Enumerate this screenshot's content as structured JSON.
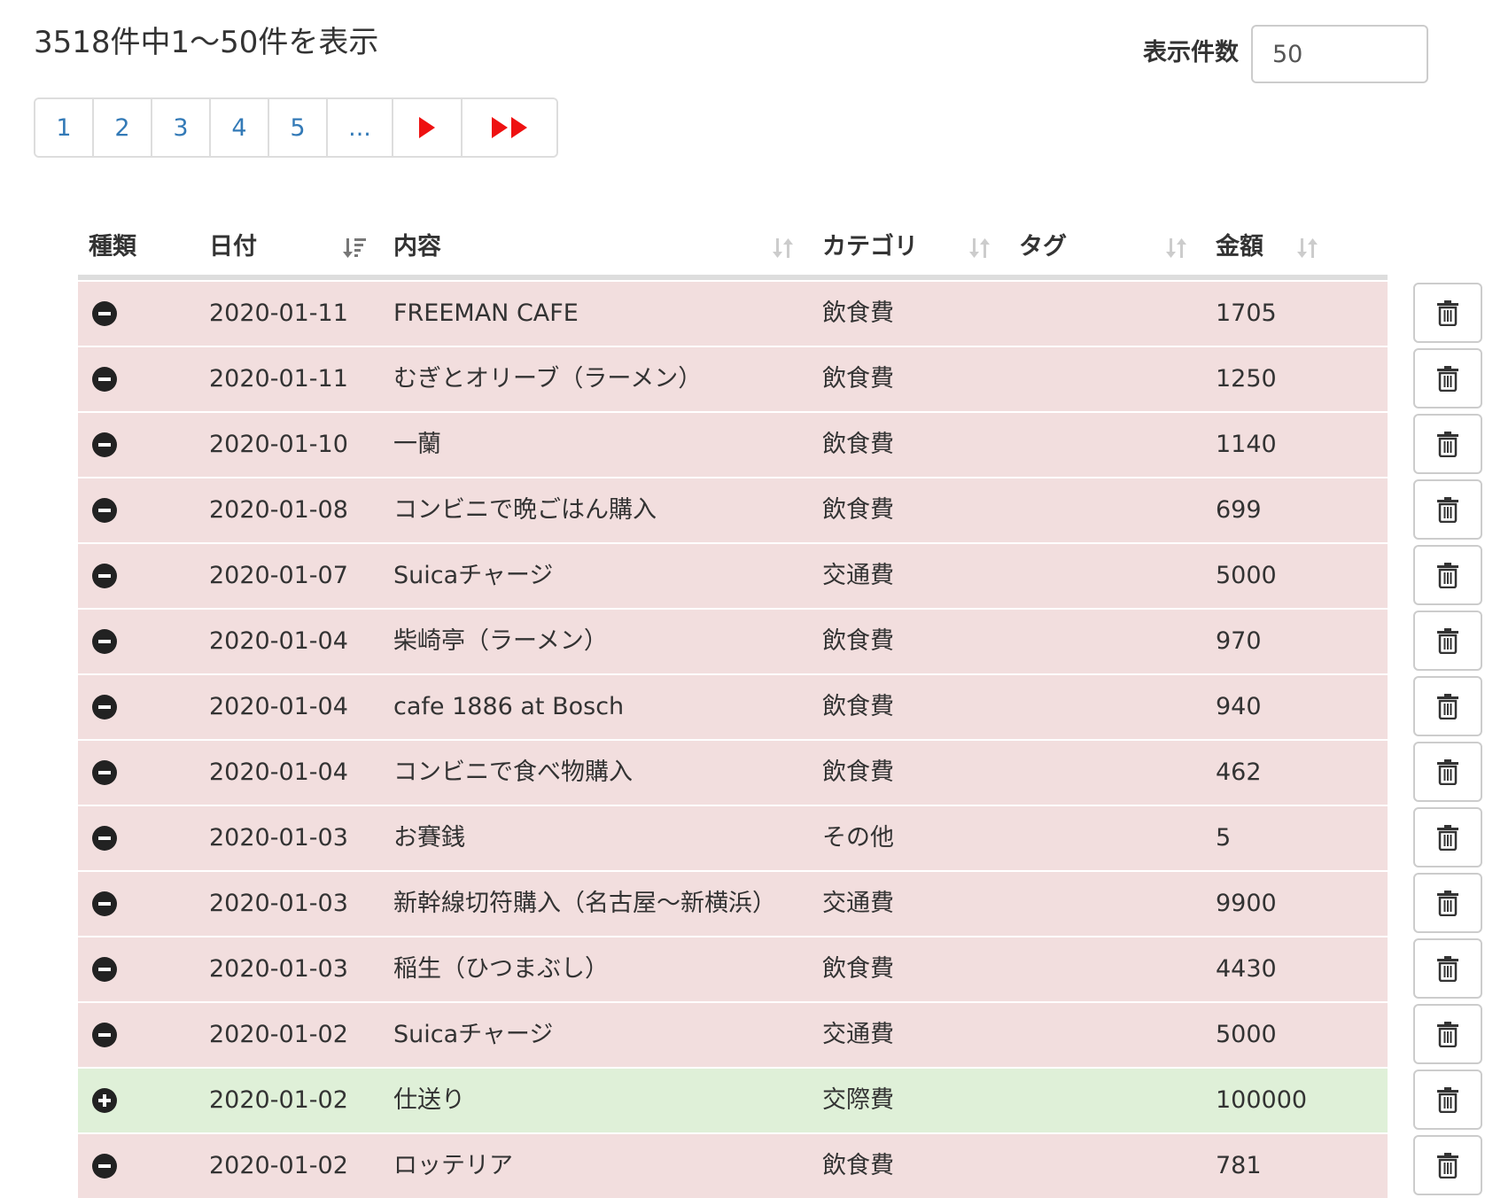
{
  "summary": "3518件中1〜50件を表示",
  "per_page": {
    "label": "表示件数",
    "value": "50"
  },
  "pagination": {
    "pages": [
      "1",
      "2",
      "3",
      "4",
      "5"
    ],
    "ellipsis": "...",
    "next_icon": "next-triangle-icon",
    "last_icon": "last-double-triangle-icon",
    "arrow_color": "#ee1111",
    "link_color": "#337ab7"
  },
  "table": {
    "columns": {
      "type": "種類",
      "date": "日付",
      "content": "内容",
      "category": "カテゴリ",
      "tag": "タグ",
      "amount": "金額"
    },
    "rows": [
      {
        "kind": "expense",
        "date": "2020-01-11",
        "content": "FREEMAN CAFE",
        "category": "飲食費",
        "tag": "",
        "amount": "1705"
      },
      {
        "kind": "expense",
        "date": "2020-01-11",
        "content": "むぎとオリーブ（ラーメン）",
        "category": "飲食費",
        "tag": "",
        "amount": "1250"
      },
      {
        "kind": "expense",
        "date": "2020-01-10",
        "content": "一蘭",
        "category": "飲食費",
        "tag": "",
        "amount": "1140"
      },
      {
        "kind": "expense",
        "date": "2020-01-08",
        "content": "コンビニで晩ごはん購入",
        "category": "飲食費",
        "tag": "",
        "amount": "699"
      },
      {
        "kind": "expense",
        "date": "2020-01-07",
        "content": "Suicaチャージ",
        "category": "交通費",
        "tag": "",
        "amount": "5000"
      },
      {
        "kind": "expense",
        "date": "2020-01-04",
        "content": "柴崎亭（ラーメン）",
        "category": "飲食費",
        "tag": "",
        "amount": "970"
      },
      {
        "kind": "expense",
        "date": "2020-01-04",
        "content": "cafe 1886 at Bosch",
        "category": "飲食費",
        "tag": "",
        "amount": "940"
      },
      {
        "kind": "expense",
        "date": "2020-01-04",
        "content": "コンビニで食べ物購入",
        "category": "飲食費",
        "tag": "",
        "amount": "462"
      },
      {
        "kind": "expense",
        "date": "2020-01-03",
        "content": "お賽銭",
        "category": "その他",
        "tag": "",
        "amount": "5"
      },
      {
        "kind": "expense",
        "date": "2020-01-03",
        "content": "新幹線切符購入（名古屋〜新横浜）",
        "category": "交通費",
        "tag": "",
        "amount": "9900"
      },
      {
        "kind": "expense",
        "date": "2020-01-03",
        "content": "稲生（ひつまぶし）",
        "category": "飲食費",
        "tag": "",
        "amount": "4430"
      },
      {
        "kind": "expense",
        "date": "2020-01-02",
        "content": "Suicaチャージ",
        "category": "交通費",
        "tag": "",
        "amount": "5000"
      },
      {
        "kind": "income",
        "date": "2020-01-02",
        "content": "仕送り",
        "category": "交際費",
        "tag": "",
        "amount": "100000"
      },
      {
        "kind": "expense",
        "date": "2020-01-02",
        "content": "ロッテリア",
        "category": "飲食費",
        "tag": "",
        "amount": "781"
      }
    ],
    "row_colors": {
      "expense": "#f2dede",
      "income": "#dff0d8"
    },
    "icons": {
      "expense": "minus-circle-icon",
      "income": "plus-circle-icon",
      "delete": "trash-icon",
      "sort": "sort-icon",
      "sort_active": "sort-desc-icon"
    }
  }
}
